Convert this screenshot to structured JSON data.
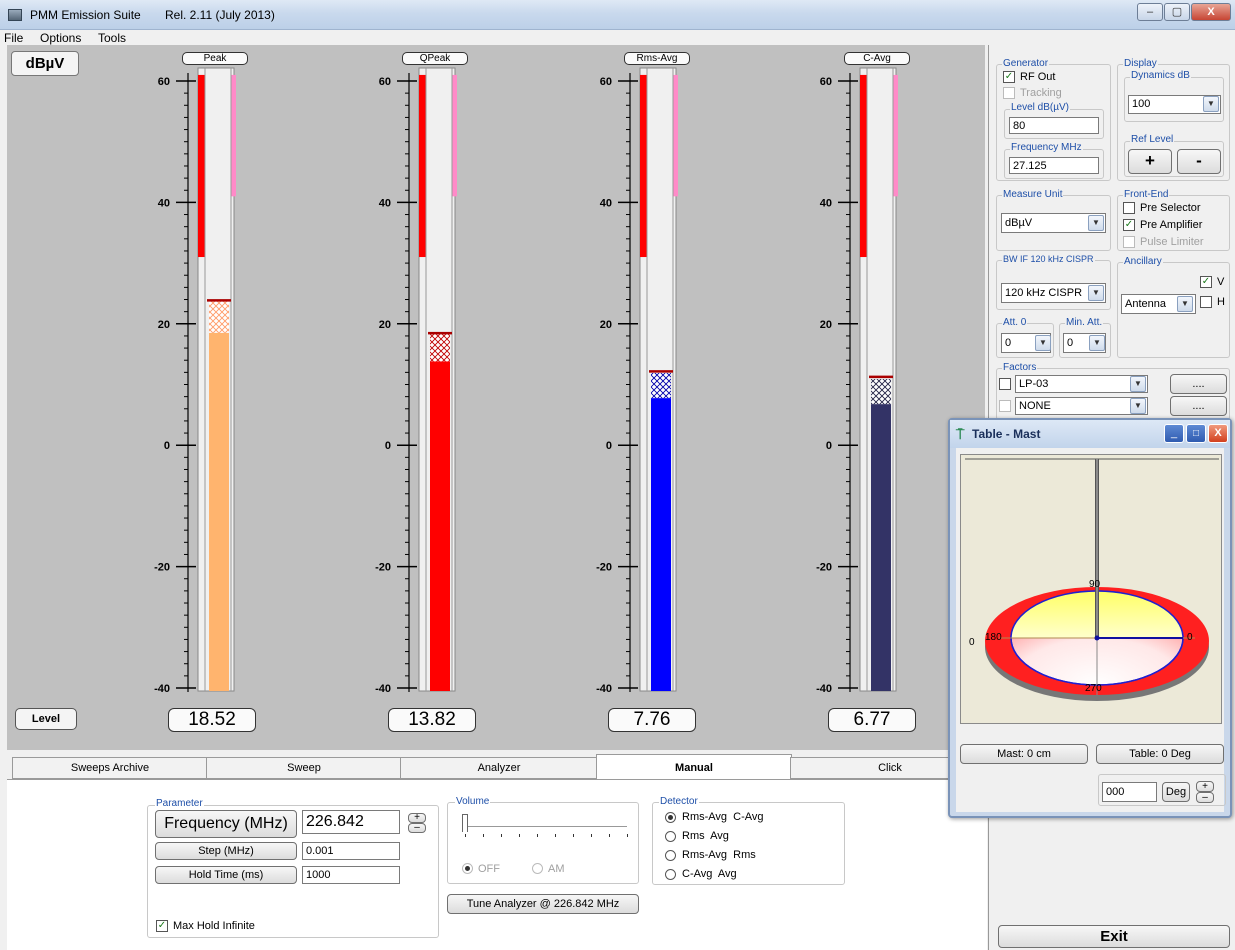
{
  "app": {
    "title": "PMM Emission Suite",
    "release": "Rel. 2.11 (July 2013)",
    "window_buttons": [
      "–",
      "▢",
      "X"
    ]
  },
  "menu": [
    "File",
    "Options",
    "Tools"
  ],
  "meter_panel": {
    "unit": "dBµV",
    "level_button": "Level",
    "scale_ticks": [
      "60",
      "40",
      "20",
      "0",
      "-20",
      "-40"
    ],
    "scale_range": [
      -40,
      60
    ],
    "meters": [
      {
        "label": "Peak",
        "value": "18.52",
        "level": 18.52,
        "fill_color": "#ffb46e",
        "hatch_color": "#ff9a66",
        "hatch_top": 23.7,
        "marker": 23.9,
        "limit_color": "#ff0000"
      },
      {
        "label": "QPeak",
        "value": "13.82",
        "level": 13.82,
        "fill_color": "#ff0000",
        "hatch_color": "#c00000",
        "hatch_top": 18.3,
        "marker": 18.5,
        "limit_color": "#ff0000"
      },
      {
        "label": "Rms-Avg",
        "value": "7.76",
        "level": 7.76,
        "fill_color": "#0000ff",
        "hatch_color": "#0000aa",
        "hatch_top": 11.9,
        "marker": 12.2,
        "limit_color": "#ff0000"
      },
      {
        "label": "C-Avg",
        "value": "6.77",
        "level": 6.77,
        "fill_color": "#333366",
        "hatch_color": "#222244",
        "hatch_top": 10.9,
        "marker": 11.3,
        "limit_color": "#ff0000"
      }
    ],
    "limit_red_top": 61,
    "limit_red_bottom": 31,
    "limit_pink_top": 61,
    "limit_pink_bottom": 41
  },
  "tabs": [
    {
      "label": "Sweeps Archive"
    },
    {
      "label": "Sweep"
    },
    {
      "label": "Analyzer"
    },
    {
      "label": "Manual"
    },
    {
      "label": "Click"
    }
  ],
  "active_tab": "Manual",
  "manual": {
    "parameter": {
      "title": "Parameter",
      "frequency_label": "Frequency (MHz)",
      "frequency_value": "226.842",
      "step_label": "Step (MHz)",
      "step_value": "0.001",
      "hold_label": "Hold Time (ms)",
      "hold_value": "1000",
      "max_hold_label": "Max Hold Infinite",
      "max_hold_checked": true,
      "plus": "+",
      "minus": "–"
    },
    "volume": {
      "title": "Volume",
      "off_label": "OFF",
      "am_label": "AM"
    },
    "tune_button": "Tune Analyzer @ 226.842 MHz",
    "detector": {
      "title": "Detector",
      "options": [
        "Rms-Avg  C-Avg",
        "Rms  Avg",
        "Rms-Avg  Rms",
        "C-Avg  Avg"
      ],
      "selected": 0
    }
  },
  "side": {
    "generator": {
      "title": "Generator",
      "rf_out": "RF Out",
      "rf_out_checked": true,
      "tracking": "Tracking",
      "level_title": "Level dB(µV)",
      "level_value": "80",
      "freq_title": "Frequency MHz",
      "freq_value": "27.125"
    },
    "display": {
      "title": "Display",
      "dynamics_title": "Dynamics dB",
      "dynamics_value": "100",
      "ref_level_title": "Ref Level",
      "plus": "+",
      "minus": "-"
    },
    "measure_unit": {
      "title": "Measure Unit",
      "value": "dBµV"
    },
    "front_end": {
      "title": "Front-End",
      "pre_selector": "Pre Selector",
      "pre_amplifier": "Pre Amplifier",
      "pulse_limiter": "Pulse Limiter",
      "pre_amplifier_checked": true
    },
    "bw": {
      "title": "BW IF 120 kHz CISPR",
      "value": "120 kHz CISPR"
    },
    "ancillary": {
      "title": "Ancillary",
      "value": "Antenna",
      "v_label": "V",
      "h_label": "H",
      "v_checked": true
    },
    "att": {
      "title": "Att. 0",
      "value": "0"
    },
    "min_att": {
      "title": "Min. Att.",
      "value": "0"
    },
    "factors": {
      "title": "Factors",
      "items": [
        "LP-03",
        "NONE"
      ],
      "dots": "...."
    },
    "exit": "Exit"
  },
  "popup": {
    "title": "Table - Mast",
    "label_90": "90",
    "label_180": "180",
    "label_0": "0",
    "label_270": "270",
    "label_left": "0",
    "mast_button": "Mast: 0 cm",
    "table_button": "Table: 0 Deg",
    "deg_value": "000",
    "deg_button": "Deg",
    "plus": "+",
    "minus": "–"
  }
}
